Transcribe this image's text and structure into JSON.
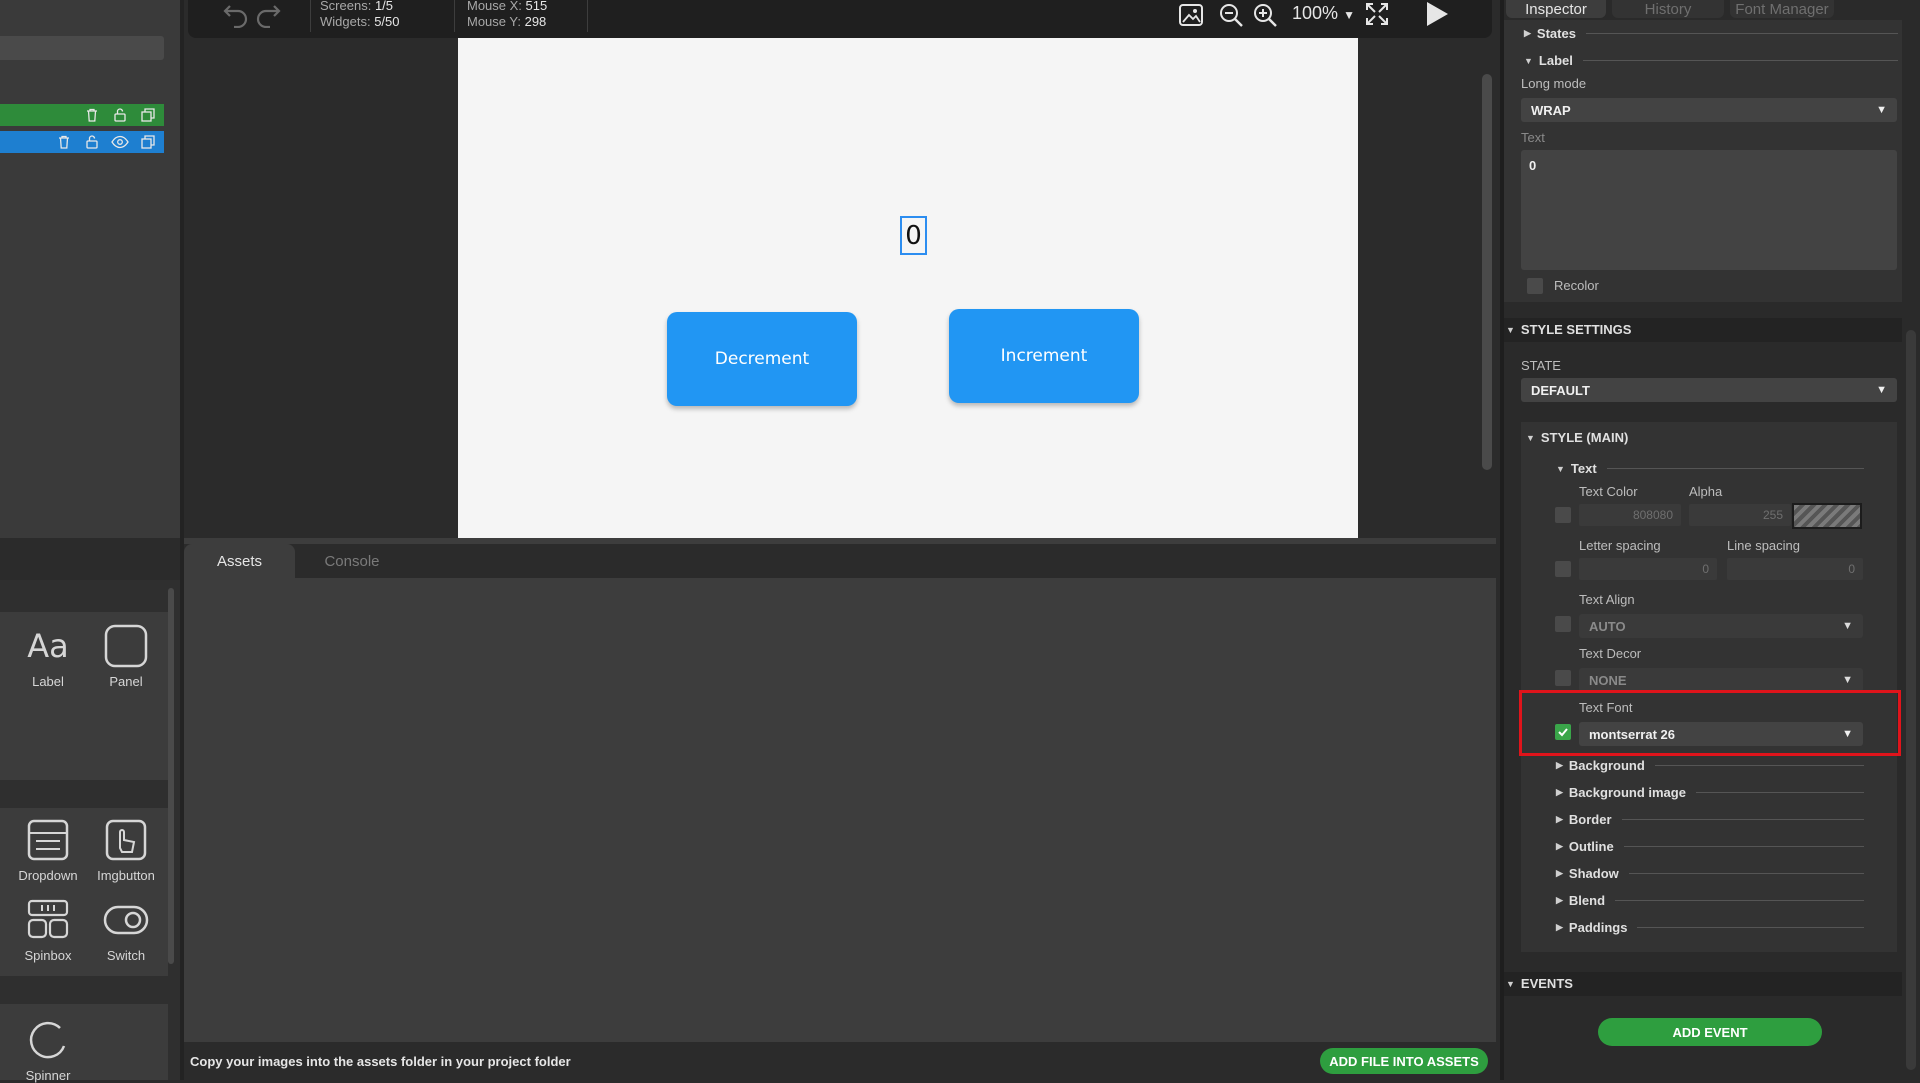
{
  "topbar": {
    "screens_label": "Screens:",
    "screens_value": "1/5",
    "widgets_label": "Widgets:",
    "widgets_value": "5/50",
    "mouse_x_label": "Mouse X:",
    "mouse_x_value": "515",
    "mouse_y_label": "Mouse Y:",
    "mouse_y_value": "298",
    "zoom": "100%"
  },
  "canvas": {
    "counter_text": "0",
    "decrement_label": "Decrement",
    "increment_label": "Increment"
  },
  "widgets": {
    "label": "Label",
    "panel": "Panel",
    "dropdown": "Dropdown",
    "imgbutton": "Imgbutton",
    "spinbox": "Spinbox",
    "switch": "Switch",
    "spinner": "Spinner"
  },
  "bottom": {
    "tab_assets": "Assets",
    "tab_console": "Console",
    "footer_text": "Copy your images into the assets folder in your project folder",
    "add_file_button": "ADD FILE INTO ASSETS"
  },
  "inspector": {
    "tabs": [
      "Inspector",
      "History",
      "Font Manager"
    ],
    "states_header": "States",
    "label_header": "Label",
    "long_mode_label": "Long mode",
    "long_mode_value": "WRAP",
    "text_label": "Text",
    "text_value": "0",
    "recolor_label": "Recolor",
    "style_settings_header": "STYLE SETTINGS",
    "state_label": "STATE",
    "state_value": "DEFAULT",
    "style_main_header": "STYLE (MAIN)",
    "text_group_header": "Text",
    "text_color_label": "Text Color",
    "text_color_value": "808080",
    "alpha_label": "Alpha",
    "alpha_value": "255",
    "letter_spacing_label": "Letter spacing",
    "letter_spacing_value": "0",
    "line_spacing_label": "Line spacing",
    "line_spacing_value": "0",
    "text_align_label": "Text Align",
    "text_align_value": "AUTO",
    "text_decor_label": "Text Decor",
    "text_decor_value": "NONE",
    "text_font_label": "Text Font",
    "text_font_value": "montserrat 26",
    "subsections": [
      "Background",
      "Background image",
      "Border",
      "Outline",
      "Shadow",
      "Blend",
      "Paddings"
    ],
    "events_header": "EVENTS",
    "add_event_button": "ADD EVENT"
  },
  "colors": {
    "accent_blue": "#2196f3",
    "green": "#2e9e3f",
    "tree_green": "#2e8b3a",
    "tree_blue": "#1e7fd0",
    "highlight_red": "#e0141b"
  }
}
